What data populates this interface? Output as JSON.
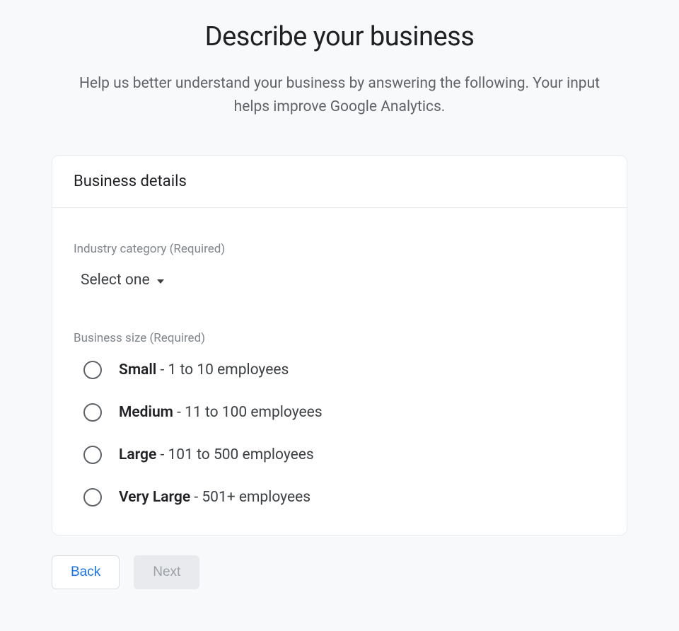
{
  "header": {
    "title": "Describe your business",
    "subtitle": "Help us better understand your business by answering the following. Your input helps improve Google Analytics."
  },
  "card": {
    "title": "Business details",
    "industry": {
      "label": "Industry category (Required)",
      "selected": "Select one"
    },
    "businessSize": {
      "label": "Business size (Required)",
      "options": [
        {
          "name": "Small",
          "desc": " - 1 to 10 employees"
        },
        {
          "name": "Medium",
          "desc": " - 11 to 100 employees"
        },
        {
          "name": "Large",
          "desc": " - 101 to 500 employees"
        },
        {
          "name": "Very Large",
          "desc": " - 501+ employees"
        }
      ]
    }
  },
  "buttons": {
    "back": "Back",
    "next": "Next"
  }
}
